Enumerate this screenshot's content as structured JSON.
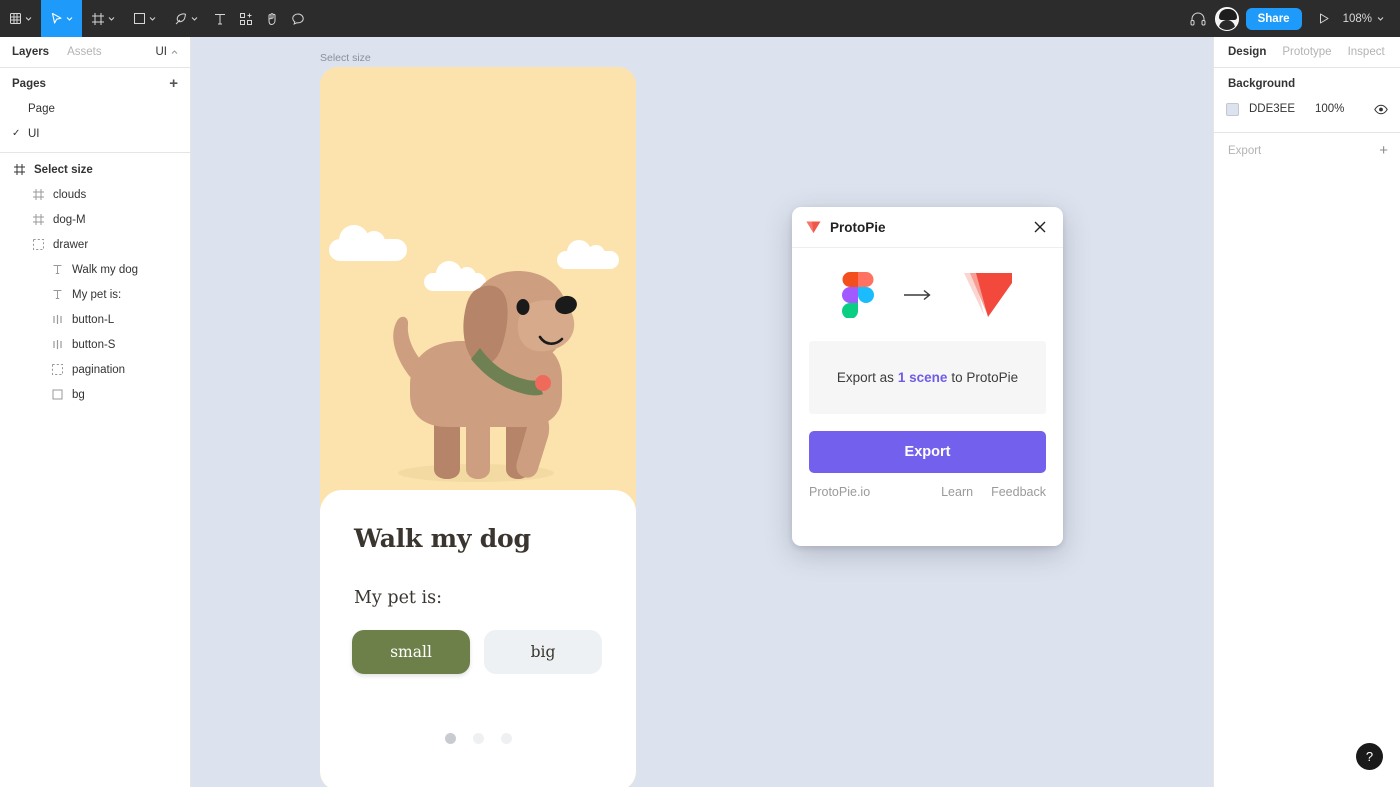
{
  "toolbar": {
    "tools": [
      {
        "name": "figma-menu-icon",
        "label": "",
        "caret": true,
        "active": false
      },
      {
        "name": "move-tool-icon",
        "label": "",
        "caret": true,
        "active": true
      },
      {
        "name": "frame-tool-icon",
        "label": "",
        "caret": true,
        "active": false
      },
      {
        "name": "shape-tool-icon",
        "label": "",
        "caret": true,
        "active": false
      },
      {
        "name": "pen-tool-icon",
        "label": "",
        "caret": true,
        "active": false
      },
      {
        "name": "text-tool-icon",
        "label": "",
        "caret": false,
        "active": false
      },
      {
        "name": "resources-tool-icon",
        "label": "",
        "caret": false,
        "active": false
      },
      {
        "name": "hand-tool-icon",
        "label": "",
        "caret": false,
        "active": false
      },
      {
        "name": "comment-tool-icon",
        "label": "",
        "caret": false,
        "active": false
      }
    ],
    "share_label": "Share",
    "zoom_level": "108%",
    "accent_blue": "#1E9BFA",
    "bar_color": "#2C2C2C"
  },
  "left_panel": {
    "tabs": [
      {
        "label": "Layers",
        "active": true
      },
      {
        "label": "Assets",
        "active": false
      }
    ],
    "page_selector": "UI",
    "pages_header": "Pages",
    "pages": [
      {
        "label": "Page",
        "selected": false
      },
      {
        "label": "UI",
        "selected": true
      }
    ],
    "layers": [
      {
        "label": "Select size",
        "icon": "frame-icon",
        "depth": 0,
        "bold": true
      },
      {
        "label": "clouds",
        "icon": "frame-icon",
        "depth": 1,
        "bold": false
      },
      {
        "label": "dog-M",
        "icon": "frame-icon",
        "depth": 1,
        "bold": false
      },
      {
        "label": "drawer",
        "icon": "group-icon",
        "depth": 1,
        "bold": false
      },
      {
        "label": "Walk my dog",
        "icon": "text-icon",
        "depth": 2,
        "bold": false
      },
      {
        "label": "My pet is:",
        "icon": "text-icon",
        "depth": 2,
        "bold": false
      },
      {
        "label": "button-L",
        "icon": "component-icon",
        "depth": 2,
        "bold": false
      },
      {
        "label": "button-S",
        "icon": "component-icon",
        "depth": 2,
        "bold": false
      },
      {
        "label": "pagination",
        "icon": "group-icon",
        "depth": 2,
        "bold": false
      },
      {
        "label": "bg",
        "icon": "rectangle-icon",
        "depth": 2,
        "bold": false
      }
    ]
  },
  "canvas": {
    "background_color": "#DDE3EE",
    "frame_label": "Select size",
    "phone": {
      "sky_color": "#FCE3AD",
      "drawer": {
        "title": "Walk my dog",
        "subtitle": "My pet is:",
        "buttons": [
          {
            "label": "small",
            "selected": true,
            "color": "#6D8049"
          },
          {
            "label": "big",
            "selected": false,
            "color": "#EDF1F3"
          }
        ],
        "pagination": [
          {
            "active": true
          },
          {
            "active": false
          },
          {
            "active": false
          }
        ]
      }
    }
  },
  "plugin": {
    "title": "ProtoPie",
    "close_label": "×",
    "scene_text_before": "Export as",
    "scene_count": "1 scene",
    "scene_text_after": "to ProtoPie",
    "export_label": "Export",
    "export_color": "#7361EE",
    "links": {
      "site": "ProtoPie.io",
      "learn": "Learn",
      "feedback": "Feedback"
    }
  },
  "right_panel": {
    "tabs": [
      {
        "label": "Design",
        "active": true
      },
      {
        "label": "Prototype",
        "active": false
      },
      {
        "label": "Inspect",
        "active": false
      }
    ],
    "background": {
      "title": "Background",
      "hex": "DDE3EE",
      "swatch_color": "#DDE3EE",
      "opacity": "100%"
    },
    "export": {
      "title": "Export"
    }
  },
  "help": {
    "label": "?"
  }
}
